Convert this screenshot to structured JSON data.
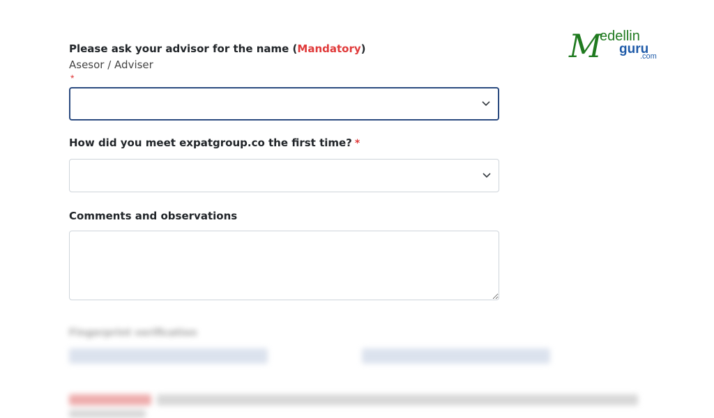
{
  "logo": {
    "big_letter": "M",
    "top_text": "edellin",
    "bottom_text": "guru",
    "tld": ".com",
    "color_green": "#1f7a1f",
    "color_blue": "#1e5aa8"
  },
  "form": {
    "adviser": {
      "label_prefix": "Please ask your advisor for the name (",
      "label_mandatory": "Mandatory",
      "label_suffix": ")",
      "sublabel": "Asesor / Adviser",
      "required_mark": "*",
      "value": ""
    },
    "meet": {
      "label": "How did you meet expatgroup.co the first time?",
      "required_mark": "*",
      "value": ""
    },
    "comments": {
      "label": "Comments and observations",
      "value": ""
    },
    "blurred_section": {
      "label": "Fingerprint verification"
    }
  },
  "colors": {
    "required": "#e03a3a",
    "focus_border": "#2a4a7f",
    "field_border": "#ced4da"
  }
}
